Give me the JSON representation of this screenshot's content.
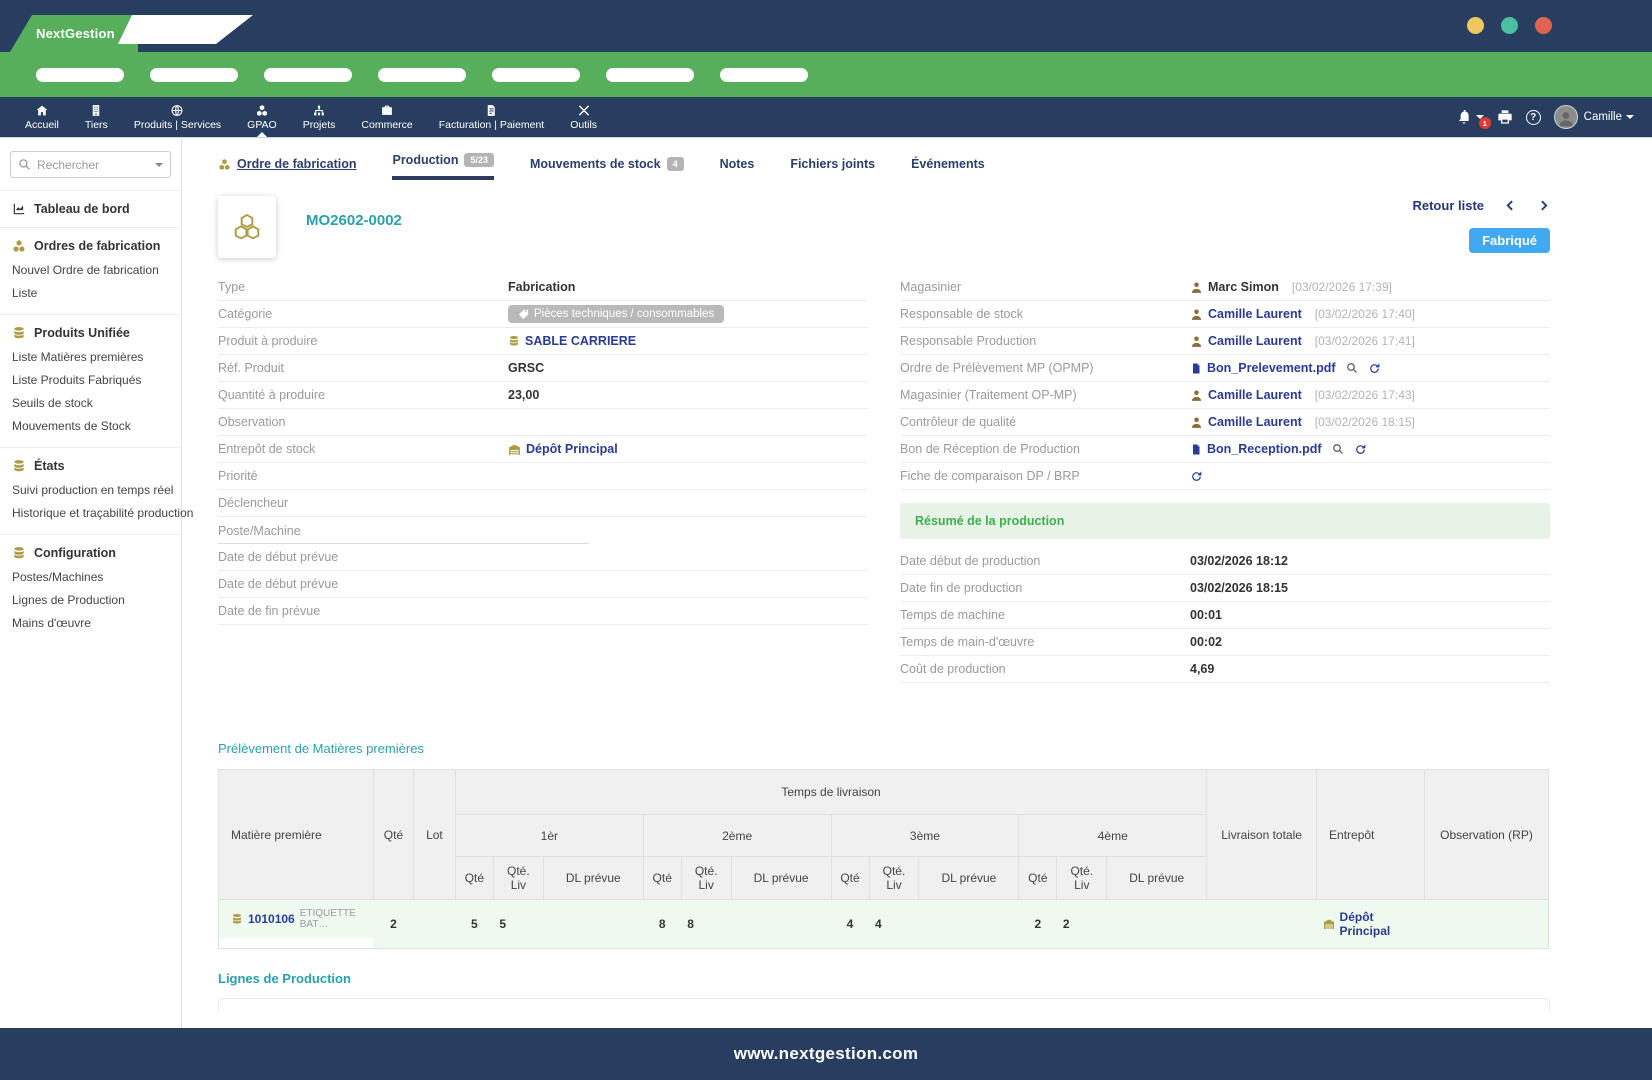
{
  "colors": {
    "navy": "#283e60",
    "green": "#57ae5b",
    "gold": "#ac9b43",
    "teal": "#2aa0ad",
    "link_blue": "#2b3a94",
    "status_badge_blue": "#41a9f1",
    "banner_green": "#3fae4e",
    "traffic_yellow": "#f0c75e",
    "traffic_teal": "#4cbfa0",
    "traffic_red": "#e26352"
  },
  "titlebar": {
    "brand": "NextGestion"
  },
  "topnav": {
    "items": [
      {
        "label": "Accueil"
      },
      {
        "label": "Tiers"
      },
      {
        "label": "Produits | Services"
      },
      {
        "label": "GPAO"
      },
      {
        "label": "Projets"
      },
      {
        "label": "Commerce"
      },
      {
        "label": "Facturation | Paiement"
      },
      {
        "label": "Outils"
      }
    ],
    "notification_count": "1",
    "help_glyph": "?",
    "user_name": "Camille"
  },
  "sidebar": {
    "search_placeholder": "Rechercher",
    "dashboard": "Tableau de bord",
    "sections": [
      {
        "title": "Ordres de fabrication",
        "items": [
          "Nouvel Ordre de fabrication",
          "Liste"
        ]
      },
      {
        "title": "Produits Unifiée",
        "items": [
          "Liste Matières premières",
          "Liste Produits Fabriqués",
          "Seuils de stock",
          "Mouvements de Stock"
        ]
      },
      {
        "title": "États",
        "items": [
          "Suivi production en temps réel",
          "Historique et traçabilité production"
        ]
      },
      {
        "title": "Configuration",
        "items": [
          "Postes/Machines",
          "Lignes de Production",
          "Mains d'œuvre"
        ]
      }
    ]
  },
  "tabs": [
    {
      "label": "Ordre de fabrication"
    },
    {
      "label": "Production",
      "badge": "5/23"
    },
    {
      "label": "Mouvements de stock",
      "badge": "4"
    },
    {
      "label": "Notes"
    },
    {
      "label": "Fichiers joints"
    },
    {
      "label": "Événements"
    }
  ],
  "header": {
    "title": "MO2602-0002",
    "back": "Retour liste",
    "status": "Fabriqué"
  },
  "details_left": {
    "rows": [
      {
        "label": "Type",
        "value": "Fabrication"
      },
      {
        "label": "Catégorie",
        "badge": "Pièces techniques / consommables"
      },
      {
        "label": "Produit à produire",
        "link": "SABLE CARRIERE"
      },
      {
        "label": "Réf. Produit",
        "value": "GRSC"
      },
      {
        "label": "Quantité à produire",
        "value": "23,00"
      },
      {
        "label": "Observation",
        "value": ""
      },
      {
        "label": "Entrepôt de stock",
        "link": "Dépôt Principal"
      },
      {
        "label": "Priorité",
        "value": ""
      },
      {
        "label": "Déclencheur",
        "value": ""
      },
      {
        "label": "Poste/Machine",
        "value": ""
      },
      {
        "label": "Date de début prévue",
        "value": ""
      },
      {
        "label": "Date de début prévue",
        "value": ""
      },
      {
        "label": "Date de fin prévue",
        "value": ""
      }
    ]
  },
  "details_right": {
    "rows": [
      {
        "label": "Magasinier",
        "name": "Marc Simon",
        "time": "[03/02/2026 17:39]"
      },
      {
        "label": "Responsable de stock",
        "name": "Camille Laurent",
        "time": "[03/02/2026 17:40]"
      },
      {
        "label": "Responsable Production",
        "name": "Camille Laurent",
        "time": "[03/02/2026 17:41]"
      },
      {
        "label": "Ordre de Prélèvement MP (OPMP)",
        "file": "Bon_Prelevement.pdf"
      },
      {
        "label": "Magasinier (Traitement OP-MP)",
        "name": "Camille Laurent",
        "time": "[03/02/2026 17:43]"
      },
      {
        "label": "Contrôleur de qualité",
        "name": "Camille Laurent",
        "time": "[03/02/2026 18:15]"
      },
      {
        "label": "Bon de Réception de Production",
        "file": "Bon_Reception.pdf"
      },
      {
        "label": "Fiche de comparaison DP / BRP"
      }
    ]
  },
  "summary": {
    "title": "Résumé de la production",
    "rows": [
      {
        "label": "Date début de production",
        "value": "03/02/2026 18:12"
      },
      {
        "label": "Date fin de production",
        "value": "03/02/2026 18:15"
      },
      {
        "label": "Temps de machine",
        "value": "00:01"
      },
      {
        "label": "Temps de main-d'œuvre",
        "value": "00:02"
      },
      {
        "label": "Coût de production",
        "value": "4,69"
      }
    ]
  },
  "materials": {
    "section_title": "Prélèvement de Matières premières",
    "headers": {
      "material": "Matière première",
      "qty": "Qté",
      "lot": "Lot",
      "delivery_group": "Temps de livraison",
      "stages": [
        "1èr",
        "2ème",
        "3ème",
        "4ème"
      ],
      "sub": [
        "Qté",
        "Qté. Liv",
        "DL prévue"
      ],
      "total": "Livraison totale",
      "warehouse": "Entrepôt",
      "observation": "Observation (RP)"
    },
    "row": {
      "code": "1010106",
      "name": "ETIQUETTE BAT…",
      "qty": "2",
      "lot": "",
      "stages": [
        {
          "q": "5",
          "liv": "5",
          "dl": ""
        },
        {
          "q": "8",
          "liv": "8",
          "dl": ""
        },
        {
          "q": "4",
          "liv": "4",
          "dl": ""
        },
        {
          "q": "2",
          "liv": "2",
          "dl": ""
        }
      ],
      "total": "",
      "warehouse": "Dépôt Principal",
      "observation": ""
    }
  },
  "production_lines": {
    "section_title": "Lignes de Production"
  },
  "footer": {
    "url": "www.nextgestion.com"
  }
}
